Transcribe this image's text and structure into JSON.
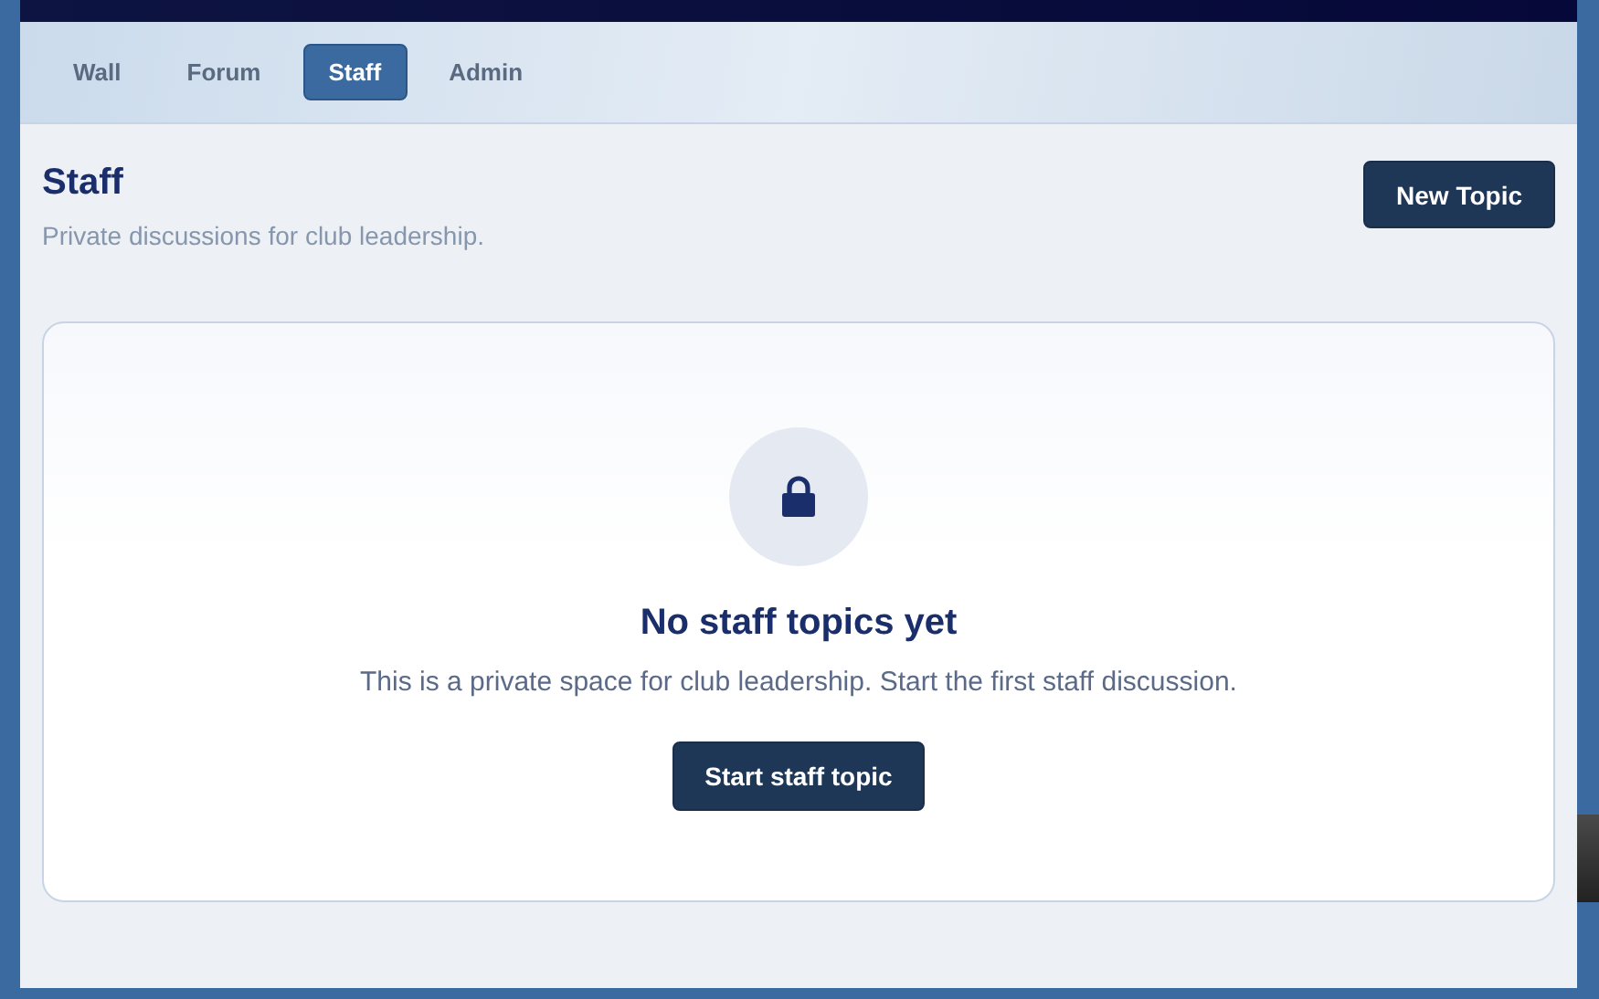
{
  "tabs": [
    {
      "label": "Wall",
      "selected": false
    },
    {
      "label": "Forum",
      "selected": false
    },
    {
      "label": "Staff",
      "selected": true
    },
    {
      "label": "Admin",
      "selected": false
    }
  ],
  "header": {
    "title": "Staff",
    "subtitle": "Private discussions for club leadership.",
    "button": "New Topic"
  },
  "empty_state": {
    "title": "No staff topics yet",
    "message": "This is a private space for club leadership. Start the first staff discussion.",
    "button": "Start staff topic"
  }
}
